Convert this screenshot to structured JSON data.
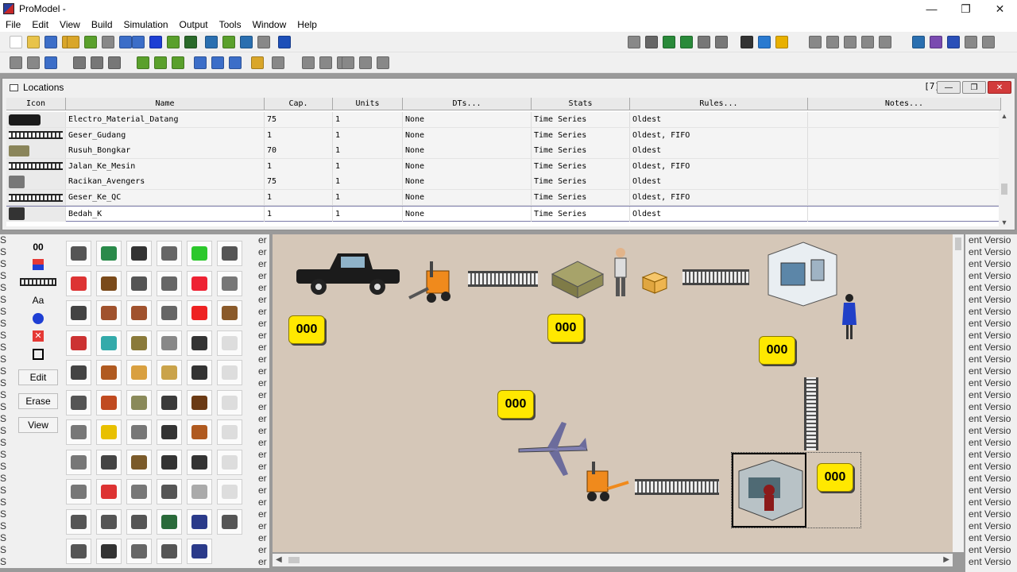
{
  "app": {
    "title": "ProModel -"
  },
  "window_controls": {
    "minimize": "—",
    "restore": "❐",
    "close": "✕"
  },
  "menu": [
    "File",
    "Edit",
    "View",
    "Build",
    "Simulation",
    "Output",
    "Tools",
    "Window",
    "Help"
  ],
  "locations_window": {
    "title": "Locations",
    "count": "[7]",
    "columns": [
      "Icon",
      "Name",
      "Cap.",
      "Units",
      "DTs...",
      "Stats",
      "Rules...",
      "Notes..."
    ],
    "rows": [
      {
        "icon": "truck-icon",
        "name": "Electro_Material_Datang",
        "cap": "75",
        "units": "1",
        "dts": "None",
        "stats": "Time Series",
        "rules": "Oldest",
        "notes": ""
      },
      {
        "icon": "conveyor-icon",
        "name": "Geser_Gudang",
        "cap": "1",
        "units": "1",
        "dts": "None",
        "stats": "Time Series",
        "rules": "Oldest, FIFO",
        "notes": ""
      },
      {
        "icon": "pallet-icon",
        "name": "Rusuh_Bongkar",
        "cap": "70",
        "units": "1",
        "dts": "None",
        "stats": "Time Series",
        "rules": "Oldest",
        "notes": ""
      },
      {
        "icon": "conveyor-icon",
        "name": "Jalan_Ke_Mesin",
        "cap": "1",
        "units": "1",
        "dts": "None",
        "stats": "Time Series",
        "rules": "Oldest, FIFO",
        "notes": ""
      },
      {
        "icon": "machine-icon",
        "name": "Racikan_Avengers",
        "cap": "75",
        "units": "1",
        "dts": "None",
        "stats": "Time Series",
        "rules": "Oldest",
        "notes": ""
      },
      {
        "icon": "conveyor-icon",
        "name": "Geser_Ke_QC",
        "cap": "1",
        "units": "1",
        "dts": "None",
        "stats": "Time Series",
        "rules": "Oldest, FIFO",
        "notes": ""
      },
      {
        "icon": "workstation-icon",
        "name": "Bedah_K",
        "cap": "1",
        "units": "1",
        "dts": "None",
        "stats": "Time Series",
        "rules": "Oldest",
        "notes": ""
      }
    ]
  },
  "graphics_panel": {
    "tools": [
      "00",
      "Aa"
    ],
    "buttons": [
      "Edit",
      "Erase",
      "View"
    ]
  },
  "layout": {
    "counters": [
      "000",
      "000",
      "000",
      "000",
      "000"
    ]
  },
  "side_strip_text": "ent Versio",
  "colors": {
    "counter": "#ffe800",
    "layout_bg": "#d5c7b8",
    "accent_red": "#d23b3b"
  }
}
